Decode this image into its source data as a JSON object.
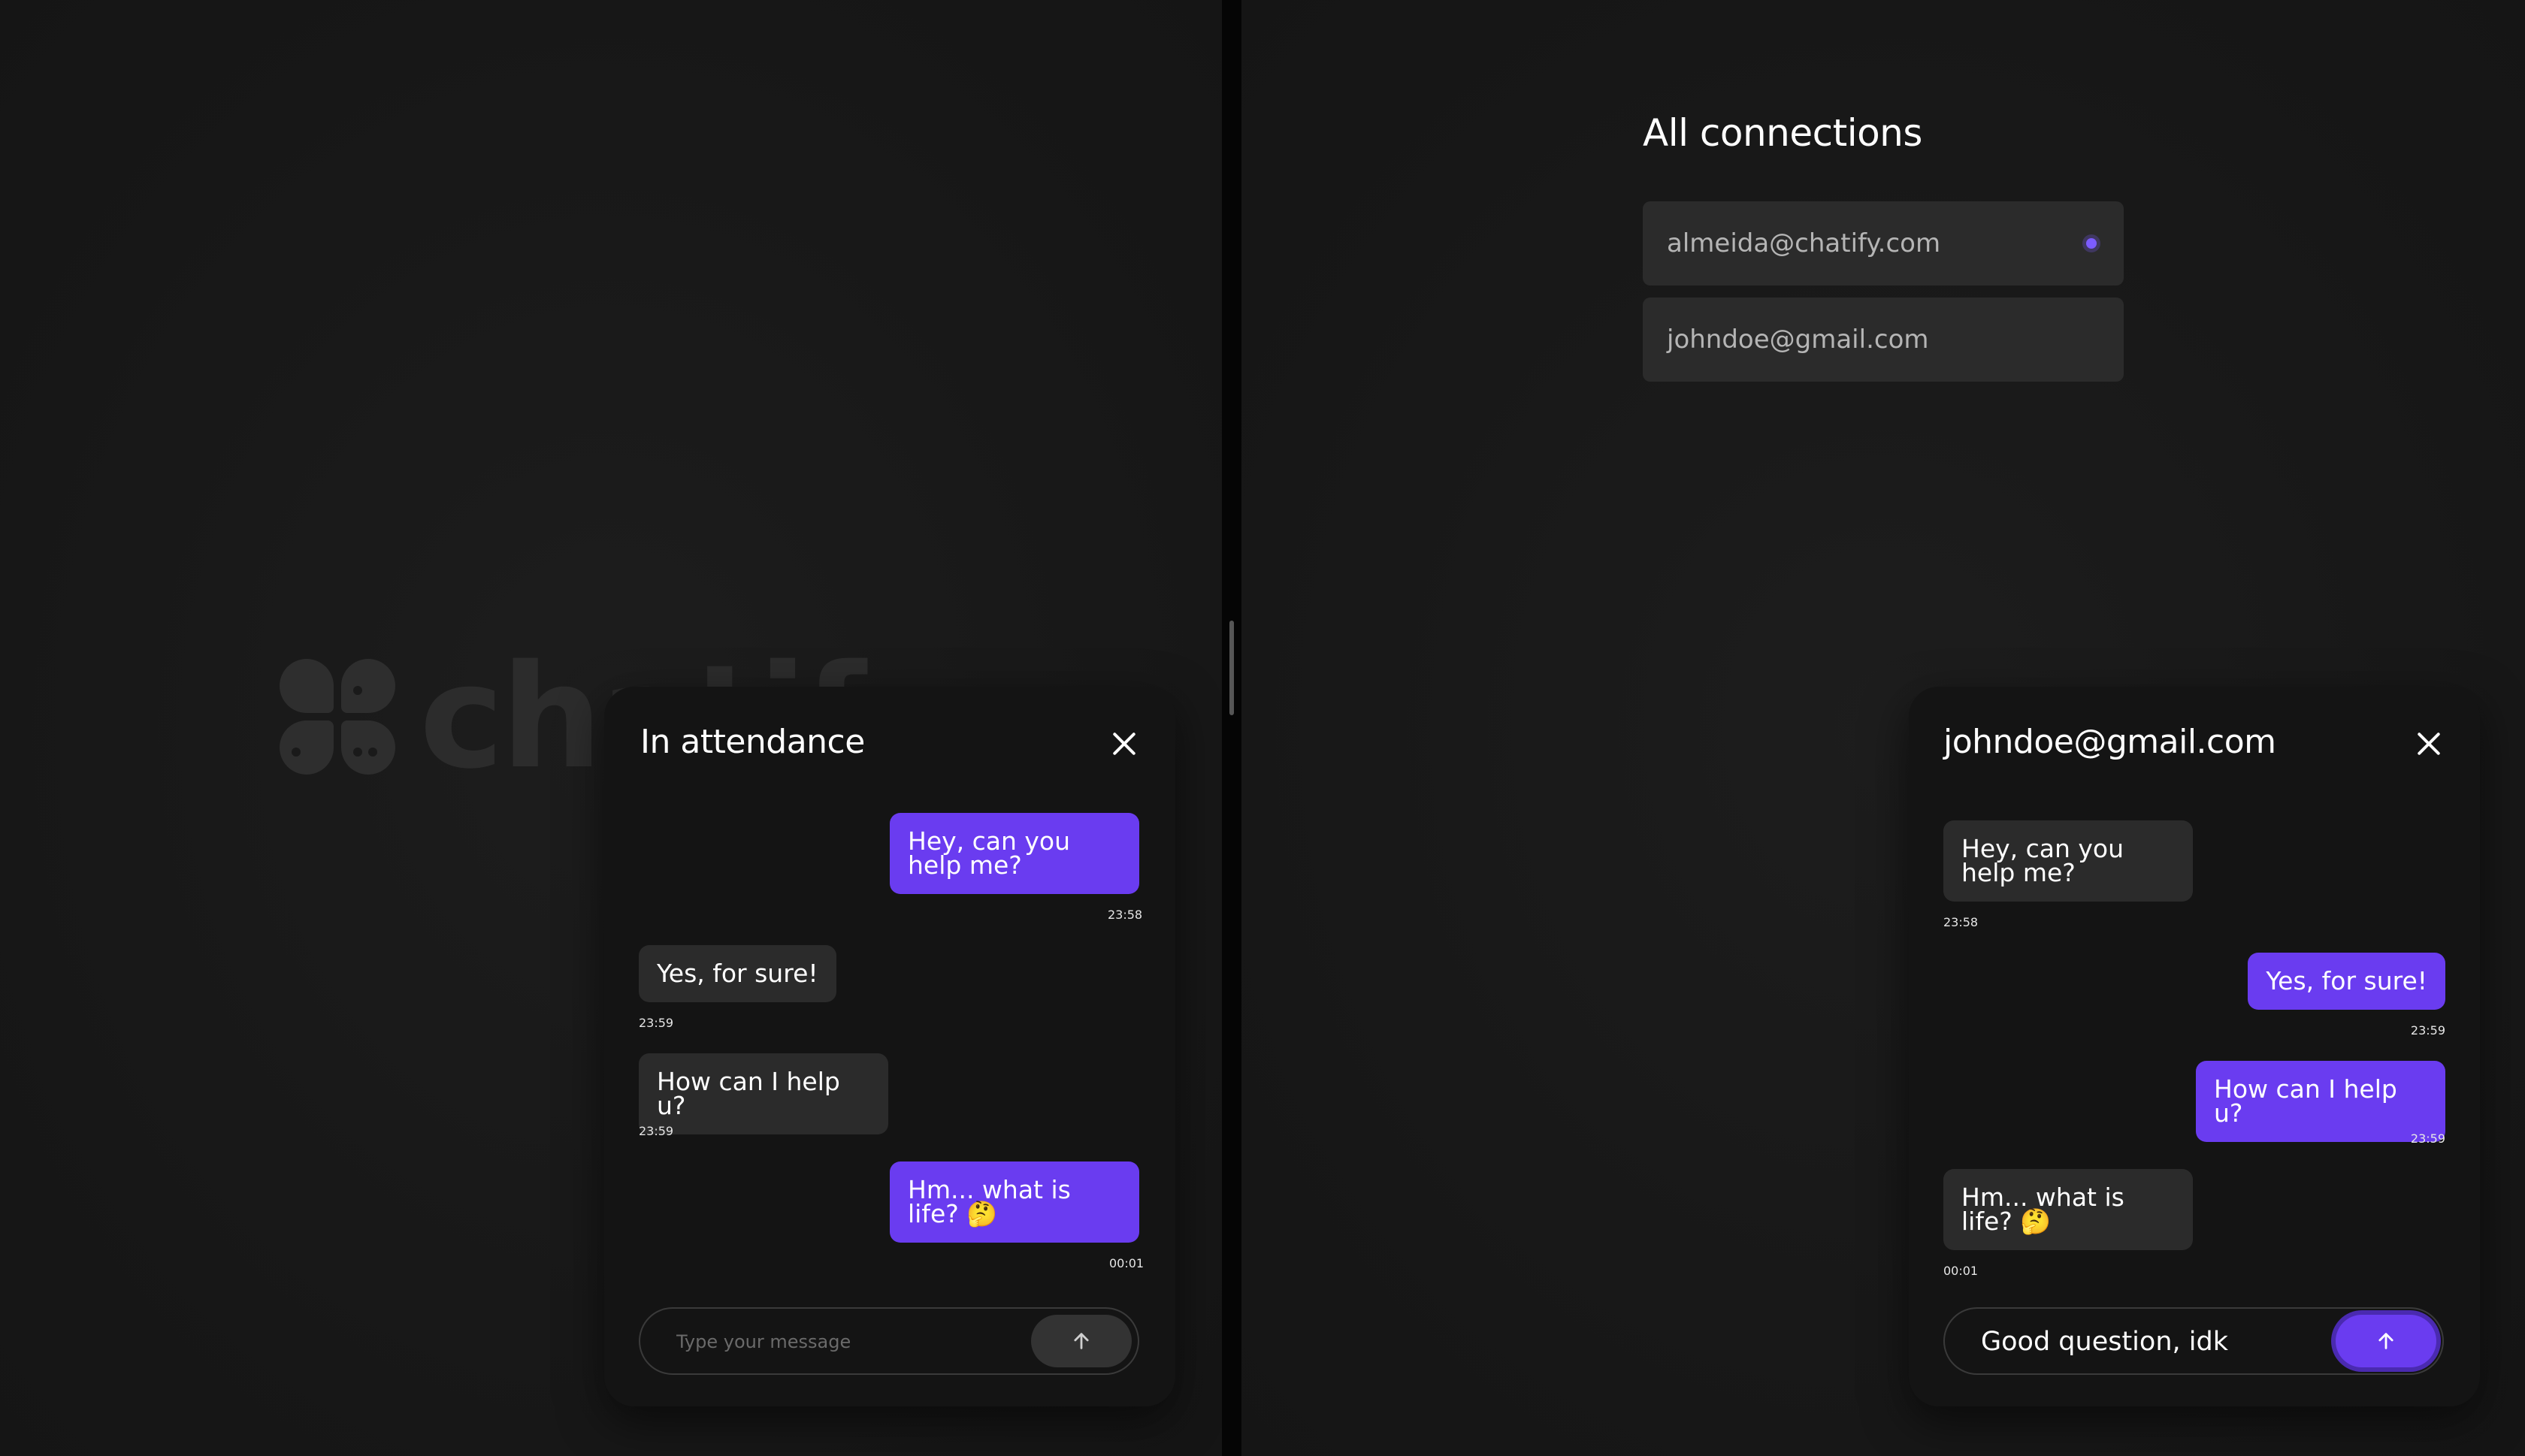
{
  "brand": {
    "name": "chatify"
  },
  "left_chat": {
    "title": "In attendance",
    "messages": [
      {
        "text": "Hey, can you help me?",
        "time": "23:58",
        "side": "sent"
      },
      {
        "text": "Yes, for sure!",
        "time": "23:59",
        "side": "recv"
      },
      {
        "text": "How can I help u?",
        "time": "23:59",
        "side": "recv"
      },
      {
        "text": "Hm... what is life? 🤔",
        "time": "00:01",
        "side": "sent"
      }
    ],
    "composer": {
      "placeholder": "Type your message",
      "value": ""
    }
  },
  "connections": {
    "title": "All connections",
    "items": [
      {
        "email": "almeida@chatify.com",
        "unread": true
      },
      {
        "email": "johndoe@gmail.com",
        "unread": false
      }
    ]
  },
  "right_chat": {
    "title": "johndoe@gmail.com",
    "messages": [
      {
        "text": "Hey, can you help me?",
        "time": "23:58",
        "side": "recv"
      },
      {
        "text": "Yes, for sure!",
        "time": "23:59",
        "side": "sent"
      },
      {
        "text": "How can I help u?",
        "time": "23:59",
        "side": "sent"
      },
      {
        "text": "Hm... what is life? 🤔",
        "time": "00:01",
        "side": "recv"
      }
    ],
    "composer": {
      "placeholder": "Type your message",
      "value": "Good question, idk"
    }
  },
  "colors": {
    "accent": "#6a3cf0",
    "received_bubble": "#2b2b2b",
    "background": "#171717"
  },
  "icons": {
    "close": "close-icon",
    "send": "arrow-up-icon",
    "unread": "unread-dot-icon"
  }
}
